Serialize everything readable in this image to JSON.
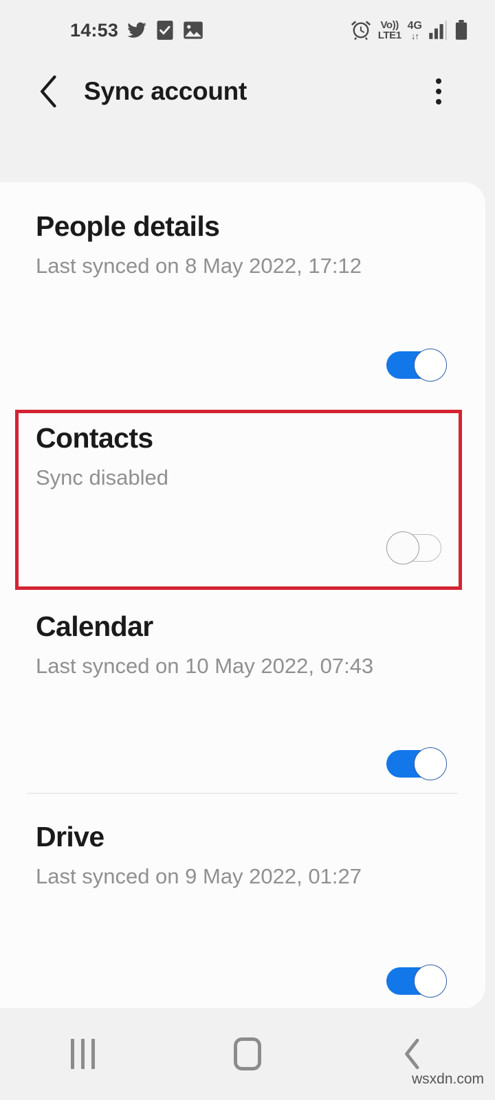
{
  "status_bar": {
    "clock": "14:53",
    "left_icons": [
      "twitter-icon",
      "task-checkbox-icon",
      "image-icon"
    ],
    "alarm_icon": "alarm-icon",
    "volte_top": "Vo))",
    "volte_bottom": "LTE1",
    "network_type": "4G",
    "data_arrows": "↓↑",
    "signal_icon": "signal-bars-icon",
    "battery_icon": "battery-icon"
  },
  "toolbar": {
    "back_icon": "back-chevron-icon",
    "title": "Sync account",
    "overflow_icon": "more-vertical-icon"
  },
  "sync_items": [
    {
      "id": "people-details",
      "title": "People details",
      "subtitle": "Last synced on 8 May 2022, 17:12",
      "toggle_state": "on",
      "highlighted": false
    },
    {
      "id": "contacts",
      "title": "Contacts",
      "subtitle": "Sync disabled",
      "toggle_state": "off",
      "highlighted": true
    },
    {
      "id": "calendar",
      "title": "Calendar",
      "subtitle": "Last synced on 10 May 2022, 07:43",
      "toggle_state": "on",
      "highlighted": false
    },
    {
      "id": "drive",
      "title": "Drive",
      "subtitle": "Last synced on 9 May 2022, 01:27",
      "toggle_state": "on",
      "highlighted": false
    }
  ],
  "nav_bar": {
    "recents_icon": "recents-icon",
    "home_icon": "home-icon",
    "back_icon": "back-chevron-icon"
  },
  "watermark": "wsxdn.com",
  "colors": {
    "background": "#f1f1f1",
    "card": "#fcfcfc",
    "toggle_on": "#1277e8",
    "highlight_red": "#d52333",
    "title_text": "#1a1a1a",
    "subtitle_text": "#909090"
  }
}
